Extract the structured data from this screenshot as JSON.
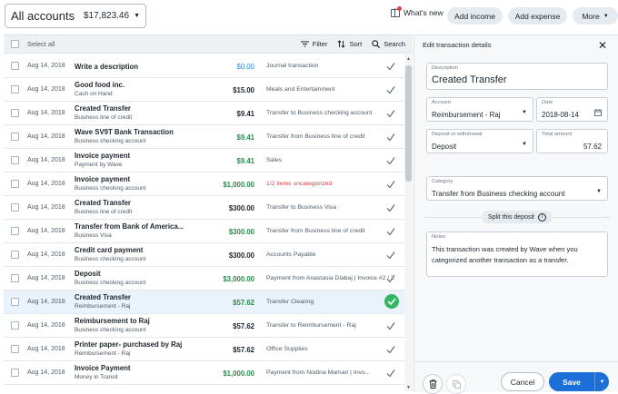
{
  "topbar": {
    "account_name": "All accounts",
    "account_balance": "$17,823.46",
    "whats_new": "What's new",
    "add_income": "Add income",
    "add_expense": "Add expense",
    "more": "More"
  },
  "list_header": {
    "select_all": "Select all",
    "filter": "Filter",
    "sort": "Sort",
    "search": "Search"
  },
  "transactions": [
    {
      "date": "Aug 14, 2018",
      "title": "Write a description",
      "sub": "",
      "amount": "$0.00",
      "amount_style": "blue",
      "category": "Journal transaction",
      "category_style": "",
      "reviewed": true,
      "selected": false
    },
    {
      "date": "Aug 14, 2018",
      "title": "Good food inc.",
      "sub": "Cash on Hand",
      "amount": "$15.00",
      "amount_style": "",
      "category": "Meals and Entertainment",
      "category_style": "",
      "reviewed": true,
      "selected": false
    },
    {
      "date": "Aug 14, 2018",
      "title": "Created Transfer",
      "sub": "Business line of credit",
      "amount": "$9.41",
      "amount_style": "",
      "category": "Transfer to Business checking account",
      "category_style": "",
      "reviewed": true,
      "selected": false
    },
    {
      "date": "Aug 14, 2018",
      "title": "Wave SV9T Bank Transaction",
      "sub": "Business checking account",
      "amount": "$9.41",
      "amount_style": "green",
      "category": "Transfer from Business line of credit",
      "category_style": "",
      "reviewed": true,
      "selected": false
    },
    {
      "date": "Aug 14, 2018",
      "title": "Invoice payment",
      "sub": "Payment by Wave",
      "amount": "$9.41",
      "amount_style": "green",
      "category": "Sales",
      "category_style": "",
      "reviewed": true,
      "selected": false
    },
    {
      "date": "Aug 14, 2018",
      "title": "Invoice payment",
      "sub": "Business checking account",
      "amount": "$1,000.00",
      "amount_style": "green",
      "category": "1/2 items uncategorized",
      "category_style": "red",
      "reviewed": true,
      "selected": false
    },
    {
      "date": "Aug 14, 2018",
      "title": "Created Transfer",
      "sub": "Business line of credit",
      "amount": "$300.00",
      "amount_style": "",
      "category": "Transfer to Business Visa",
      "category_style": "",
      "reviewed": true,
      "selected": false
    },
    {
      "date": "Aug 14, 2018",
      "title": "Transfer from Bank of America...",
      "sub": "Business Visa",
      "amount": "$300.00",
      "amount_style": "green",
      "category": "Transfer from Business line of credit",
      "category_style": "",
      "reviewed": true,
      "selected": false
    },
    {
      "date": "Aug 14, 2018",
      "title": "Credit card payment",
      "sub": "Business checking account",
      "amount": "$300.00",
      "amount_style": "",
      "category": "Accounts Payable",
      "category_style": "",
      "reviewed": true,
      "selected": false
    },
    {
      "date": "Aug 14, 2018",
      "title": "Deposit",
      "sub": "Business checking account",
      "amount": "$3,000.00",
      "amount_style": "green",
      "category": "Payment from Anastasia Dlabaj | Invoice #2 / 2",
      "category_style": "",
      "reviewed": true,
      "selected": false
    },
    {
      "date": "Aug 14, 2018",
      "title": "Created Transfer",
      "sub": "Reimbursement - Raj",
      "amount": "$57.62",
      "amount_style": "green",
      "category": "Transfer Clearing",
      "category_style": "",
      "reviewed": true,
      "selected": true
    },
    {
      "date": "Aug 14, 2018",
      "title": "Reimbursement to Raj",
      "sub": "Business checking account",
      "amount": "$57.62",
      "amount_style": "",
      "category": "Transfer to Reimbursement - Raj",
      "category_style": "",
      "reviewed": true,
      "selected": false
    },
    {
      "date": "Aug 14, 2018",
      "title": "Printer paper- purchased by Raj",
      "sub": "Reimbursement - Raj",
      "amount": "$57.62",
      "amount_style": "",
      "category": "Office Supplies",
      "category_style": "",
      "reviewed": true,
      "selected": false
    },
    {
      "date": "Aug 14, 2018",
      "title": "Invoice Payment",
      "sub": "Money in Transit",
      "amount": "$1,000.00",
      "amount_style": "green",
      "category": "Payment from Nodina Mamari | Invo...",
      "category_style": "",
      "reviewed": true,
      "selected": false
    }
  ],
  "panel": {
    "title": "Edit transaction details",
    "description_label": "Description",
    "description_value": "Created Transfer",
    "account_label": "Account",
    "account_value": "Reimbursement - Raj",
    "date_label": "Date",
    "date_value": "2018-08-14",
    "type_label": "Deposit or withdrawal",
    "type_value": "Deposit",
    "total_label": "Total amount",
    "total_value": "57.62",
    "category_label": "Category",
    "category_value": "Transfer from Business checking account",
    "split_label": "Split this deposit",
    "notes_label": "Notes",
    "notes_value": "This transaction was created by Wave when you categorized another transaction as a transfer.",
    "cancel": "Cancel",
    "save": "Save"
  },
  "colors": {
    "primary": "#1c6fd6",
    "green": "#2d8a4e",
    "red": "#d74242",
    "selected_row": "#eaf2fb"
  }
}
